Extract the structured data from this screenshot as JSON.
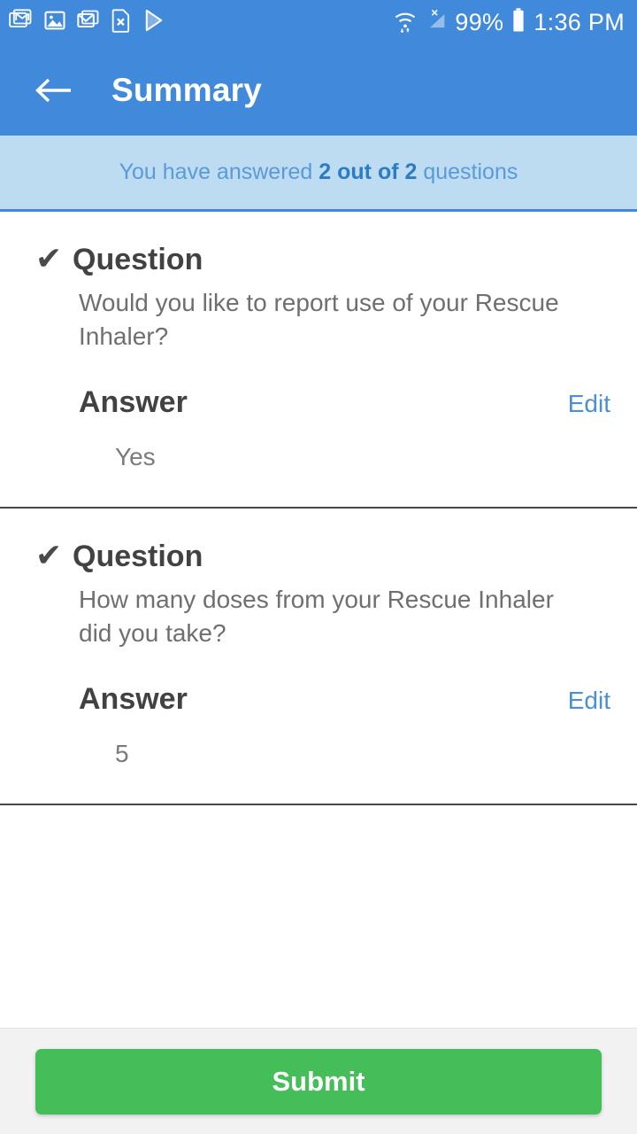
{
  "status_bar": {
    "icons": [
      "gmail-icon",
      "photos-icon",
      "email-icon",
      "file-x-icon",
      "play-store-icon"
    ],
    "wifi_icon": "wifi-icon",
    "signal_icon": "cellular-no-signal-icon",
    "battery_percent": "99%",
    "battery_icon": "battery-full-icon",
    "time": "1:36 PM"
  },
  "app_bar": {
    "back_icon": "back-arrow-icon",
    "title": "Summary"
  },
  "banner": {
    "prefix": "You have answered ",
    "highlight": "2 out of 2",
    "suffix": " questions"
  },
  "questions": [
    {
      "check_icon": "check-icon",
      "question_label": "Question",
      "question_text": "Would you like to report use of your Rescue Inhaler?",
      "answer_label": "Answer",
      "edit_label": "Edit",
      "answer_value": "Yes"
    },
    {
      "check_icon": "check-icon",
      "question_label": "Question",
      "question_text": "How many doses from your Rescue Inhaler did you take?",
      "answer_label": "Answer",
      "edit_label": "Edit",
      "answer_value": "5"
    }
  ],
  "footer": {
    "submit_label": "Submit"
  },
  "colors": {
    "header_blue": "#4189db",
    "banner_bg": "#bddcf1",
    "banner_text": "#5a9ad8",
    "banner_highlight": "#2c7cc4",
    "link_blue": "#4a90d2",
    "submit_green": "#45bd58",
    "divider": "#464646",
    "text_dark": "#424242",
    "text_muted": "#6f6f6f"
  }
}
